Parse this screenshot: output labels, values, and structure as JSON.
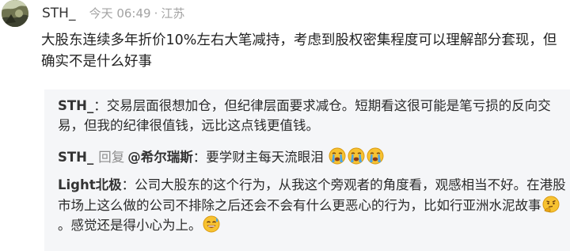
{
  "comment": {
    "author": "STH_",
    "time": "今天 06:49",
    "separator": "·",
    "location": "江苏",
    "text": "大股东连续多年折价10%左右大笔减持，考虑到股权密集程度可以理解部分套现，但确实不是什么好事"
  },
  "replies": [
    {
      "author": "STH_",
      "colon": "：",
      "text": "交易层面很想加仓，但纪律层面要求减仓。短期看这很可能是笔亏损的反向交易，但我的纪律很值钱，远比这点钱更值钱。"
    },
    {
      "author": "STH_",
      "reply_word": "回复",
      "mention": "@希尔瑞斯",
      "colon": "：",
      "text": "要学财主每天流眼泪",
      "emojis": [
        "crying-face-icon",
        "crying-face-icon",
        "crying-face-icon"
      ]
    },
    {
      "author": "Light北极",
      "colon": "：",
      "text_before": "公司大股东的这个行为，从我这个旁观者的角度看，观感相当不好。在港股市场上这么做的公司不排除之后还会不会有什么更恶心的行为，比如行亚洲水泥故事",
      "emoji_mid": "thinking-face-icon",
      "text_after": "。感觉还是得小心为上。",
      "emoji_end": "grinning-sweat-icon"
    }
  ],
  "colors": {
    "reply_background": "#f5f6f8",
    "meta": "#a3a3a3",
    "text": "#222222"
  }
}
